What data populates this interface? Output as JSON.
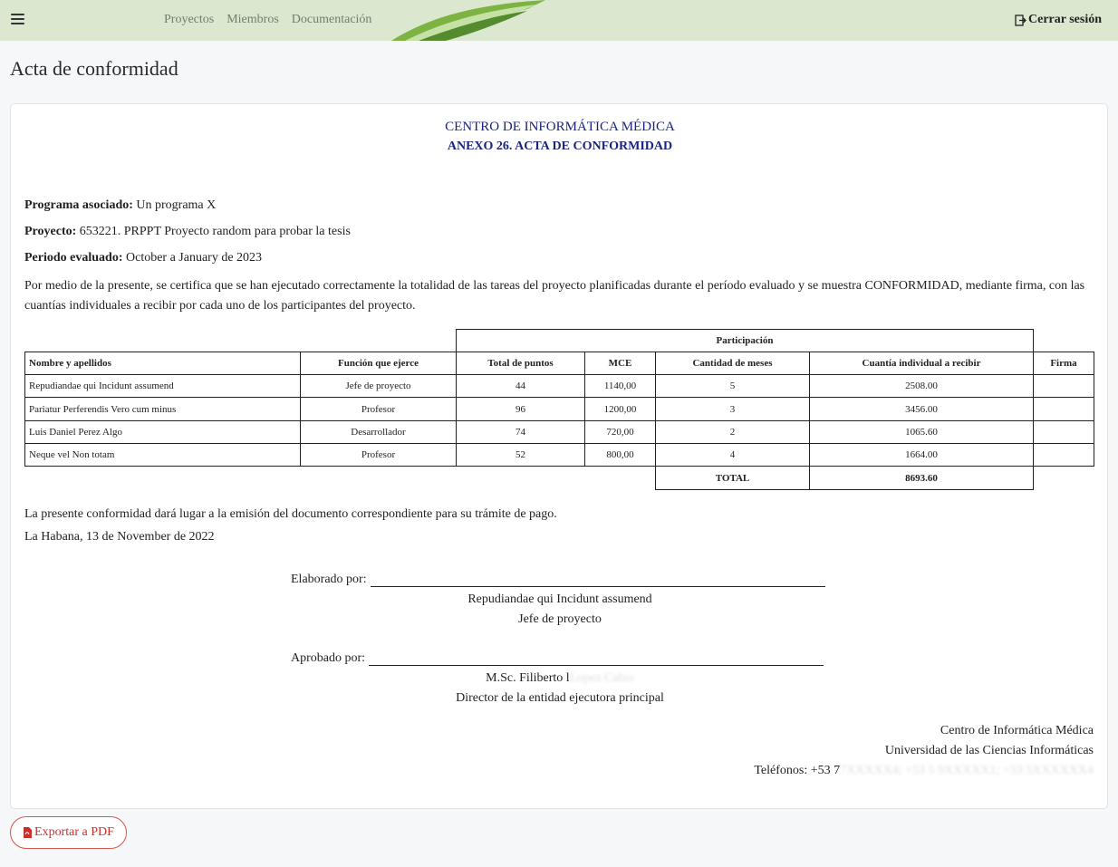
{
  "nav": {
    "links": [
      "Proyectos",
      "Miembros",
      "Documentación"
    ],
    "logout_label": "Cerrar sesión"
  },
  "page_title": "Acta de conformidad",
  "document": {
    "org": "CENTRO DE INFORMÁTICA MÉDICA",
    "title": "ANEXO 26. ACTA DE CONFORMIDAD",
    "programa_label": "Programa asociado:",
    "programa_value": " Un programa X",
    "proyecto_label": "Proyecto:",
    "proyecto_value": " 653221. PRPPT Proyecto random para probar la tesis",
    "periodo_label": "Periodo evaluado:",
    "periodo_value": " October a January de 2023",
    "paragraph": "Por medio de la presente, se certifica que se han ejecutado correctamente la totalidad de las tareas del proyecto planificadas durante el período evaluado y se muestra CONFORMIDAD, mediante firma, con las cuantías individuales a recibir por cada uno de los participantes del proyecto.",
    "table": {
      "group_header": "Participación",
      "headers": [
        "Nombre y apellidos",
        "Función que ejerce",
        "Total de puntos",
        "MCE",
        "Cantidad de meses",
        "Cuantía individual a recibir",
        "Firma"
      ],
      "rows": [
        [
          "Repudiandae qui Incidunt assumend",
          "Jefe de proyecto",
          "44",
          "1140,00",
          "5",
          "2508.00",
          ""
        ],
        [
          "Pariatur Perferendis Vero cum minus",
          "Profesor",
          "96",
          "1200,00",
          "3",
          "3456.00",
          ""
        ],
        [
          "Luis Daniel Perez Algo",
          "Desarrollador",
          "74",
          "720,00",
          "2",
          "1065.60",
          ""
        ],
        [
          "Neque vel Non totam",
          "Profesor",
          "52",
          "800,00",
          "4",
          "1664.00",
          ""
        ]
      ],
      "total_label": "TOTAL",
      "total_value": "8693.60"
    },
    "closing_1": "La presente conformidad dará lugar a la emisión del documento correspondiente para su trámite de pago.",
    "closing_2": "La Habana, 13 de November de 2022",
    "elaborado_label": "Elaborado por:",
    "elaborado_name": "Repudiandae qui Incidunt assumend",
    "elaborado_role": "Jefe de proyecto",
    "aprobado_label": "Aprobado por:",
    "aprobado_name_visible": "M.Sc. Filiberto l",
    "aprobado_name_blurred": "Lopez Calzo",
    "aprobado_role": "Director de la entidad ejecutora principal",
    "footer_org": "Centro de Informática Médica",
    "footer_univ": "Universidad de las Ciencias Informáticas",
    "footer_phones_visible": "Teléfonos: +53 7",
    "footer_phones_blurred": "7XXXXX4; +53 5 9XXXXX1; +53 5XXXXXX4"
  },
  "export_button": "Exportar a PDF",
  "colors": {
    "navbar_bg": "#dbe8cf",
    "doc_header": "#1a237e",
    "pdf_button": "#c9302c"
  }
}
